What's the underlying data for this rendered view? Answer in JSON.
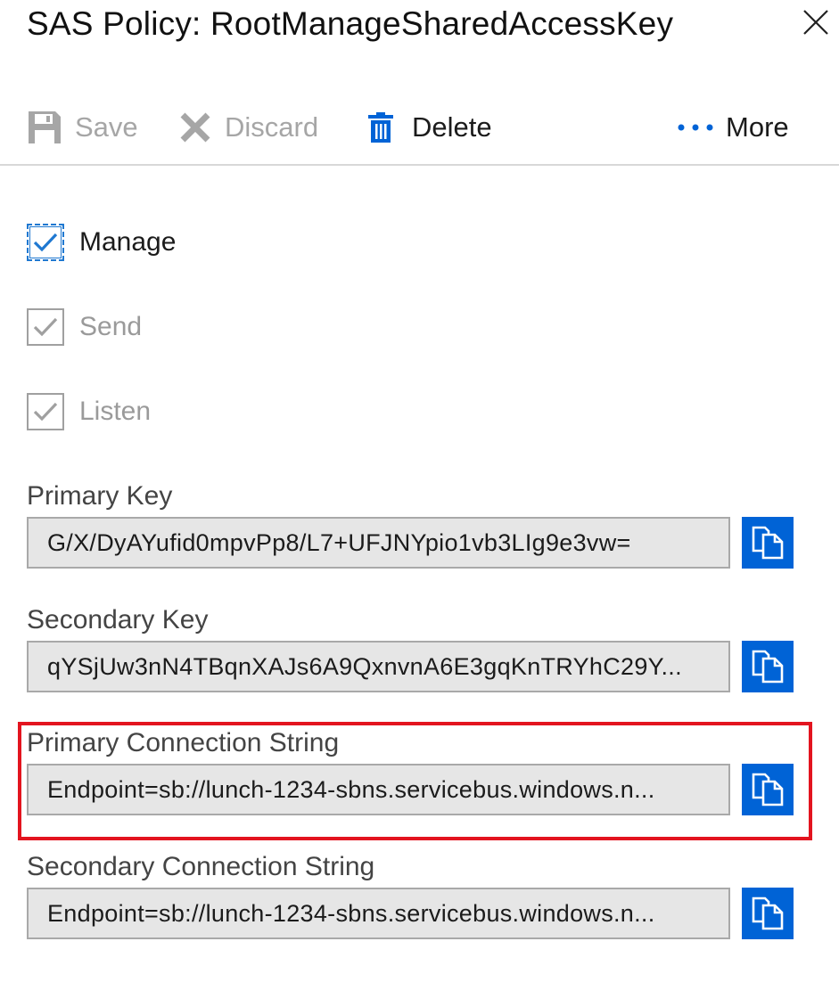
{
  "panel": {
    "title": "SAS Policy: RootManageSharedAccessKey",
    "close_icon": "close-icon"
  },
  "toolbar": {
    "save_label": "Save",
    "discard_label": "Discard",
    "delete_label": "Delete",
    "more_label": "More",
    "icons": {
      "save": "floppy-disk-icon",
      "discard": "x-icon",
      "delete": "trash-icon",
      "more": "ellipsis-icon"
    }
  },
  "claims": [
    {
      "label": "Manage",
      "checked": true,
      "enabled": true
    },
    {
      "label": "Send",
      "checked": true,
      "enabled": false
    },
    {
      "label": "Listen",
      "checked": true,
      "enabled": false
    }
  ],
  "fields": {
    "primary_key": {
      "label": "Primary Key",
      "value": "G/X/DyAYufid0mpvPp8/L7+UFJNYpio1vb3LIg9e3vw="
    },
    "secondary_key": {
      "label": "Secondary Key",
      "value": "qYSjUw3nN4TBqnXAJs6A9QxnvnA6E3gqKnTRYhC29Y..."
    },
    "primary_connection_string": {
      "label": "Primary Connection String",
      "value": "Endpoint=sb://lunch-1234-sbns.servicebus.windows.n..."
    },
    "secondary_connection_string": {
      "label": "Secondary Connection String",
      "value": "Endpoint=sb://lunch-1234-sbns.servicebus.windows.n..."
    }
  },
  "colors": {
    "accent": "#0063d6",
    "highlight": "#e3141f",
    "input_bg": "#e6e6e6",
    "disabled_text": "#a6a6a6"
  }
}
